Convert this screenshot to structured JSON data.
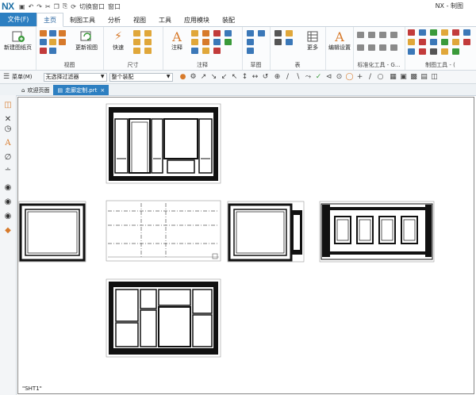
{
  "app": {
    "logo": "NX",
    "window_title": "NX - 制图",
    "quick_access": [
      "切换窗口",
      "窗口"
    ]
  },
  "menu": {
    "file_tab": "文件(F)",
    "tabs": [
      "主页",
      "制图工具",
      "分析",
      "视图",
      "工具",
      "应用模块",
      "装配"
    ],
    "active_tab": "主页"
  },
  "ribbon": {
    "groups": {
      "new_sheet": "新建图纸页",
      "view": "视图",
      "dimension": "尺寸",
      "annotation": "注释",
      "sketch": "草图",
      "table": "表",
      "std_tools": "标准化工具 - G...",
      "draft_tools": "制图工具 - ("
    },
    "buttons": {
      "base_view": "更新视图",
      "quick": "快速",
      "note": "注释",
      "more": "更多",
      "edit_settings": "编辑设置"
    }
  },
  "toolbar2": {
    "menu_label": "菜单(M)",
    "filter_value": "无选择过滤器",
    "assembly_value": "整个装配"
  },
  "doc_tabs": [
    {
      "label": "欢迎页面",
      "active": false
    },
    {
      "label": "走廊定制.prt",
      "active": true
    }
  ],
  "sheet": {
    "name": "\"SHT1\""
  },
  "colors": {
    "accent": "#2d7fc1",
    "file_tab": "#2d7fc1"
  }
}
